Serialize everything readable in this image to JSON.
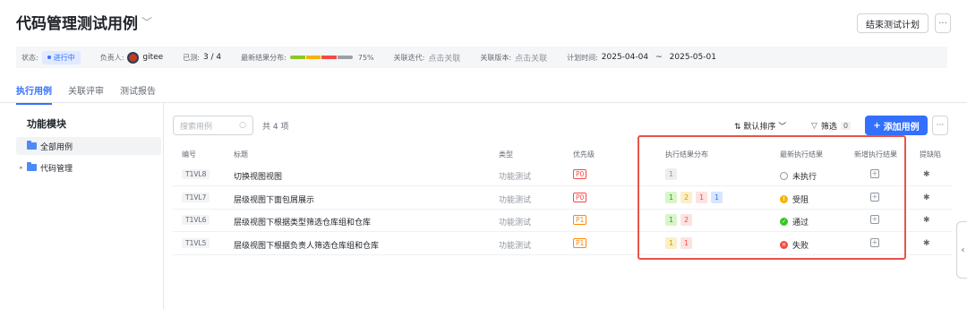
{
  "header": {
    "title": "代码管理测试用例",
    "end_button": "结束测试计划",
    "more_button": "···"
  },
  "info": {
    "status_label": "状态:",
    "status_value": "进行中",
    "owner_label": "负责人:",
    "owner_value": "gitee",
    "tested_label": "已测:",
    "tested_value": "3 / 4",
    "dist_label": "最新结果分布:",
    "dist_percent": "75%",
    "distribution": [
      {
        "color": "#8ac926",
        "fraction": 0.25
      },
      {
        "color": "#f4b400",
        "fraction": 0.25
      },
      {
        "color": "#f54a45",
        "fraction": 0.25
      },
      {
        "color": "#9aa0a6",
        "fraction": 0.25
      }
    ],
    "iteration_label": "关联迭代:",
    "iteration_value": "点击关联",
    "version_label": "关联版本:",
    "version_value": "点击关联",
    "plan_label": "计划时间:",
    "plan_start": "2025-04-04",
    "plan_sep": "~",
    "plan_end": "2025-05-01"
  },
  "tabs": [
    "执行用例",
    "关联评审",
    "测试报告"
  ],
  "sidebar": {
    "title": "功能模块",
    "items": [
      {
        "label": "全部用例"
      },
      {
        "label": "代码管理"
      }
    ]
  },
  "toolbar": {
    "search_placeholder": "搜索用例",
    "count": "共 4 项",
    "sort": "⇅ 默认排序 ﹀",
    "filter": "筛选",
    "filter_count": "0",
    "add": "添加用例",
    "more": "···"
  },
  "columns": {
    "code": "编号",
    "title": "标题",
    "type": "类型",
    "priority": "优先级",
    "dist": "执行结果分布",
    "latest": "最新执行结果",
    "new_result": "新增执行结果",
    "bug": "提缺陷"
  },
  "rows": [
    {
      "code": "T1VL8",
      "title": "切换视图视图",
      "type": "功能测试",
      "priority": "P0",
      "chips": [
        {
          "v": "1",
          "c": "c-gray"
        }
      ],
      "result": "未执行",
      "result_kind": "none"
    },
    {
      "code": "T1VL7",
      "title": "层级视图下面包屑展示",
      "type": "功能测试",
      "priority": "P0",
      "chips": [
        {
          "v": "1",
          "c": "c-green"
        },
        {
          "v": "2",
          "c": "c-yellow"
        },
        {
          "v": "1",
          "c": "c-red"
        },
        {
          "v": "1",
          "c": "c-blue"
        }
      ],
      "result": "受阻",
      "result_kind": "block"
    },
    {
      "code": "T1VL6",
      "title": "层级视图下根据类型筛选仓库组和仓库",
      "type": "功能测试",
      "priority": "P1",
      "chips": [
        {
          "v": "1",
          "c": "c-green"
        },
        {
          "v": "2",
          "c": "c-red"
        }
      ],
      "result": "通过",
      "result_kind": "pass"
    },
    {
      "code": "T1VL5",
      "title": "层级视图下根据负责人筛选仓库组和仓库",
      "type": "功能测试",
      "priority": "P1",
      "chips": [
        {
          "v": "1",
          "c": "c-yellow"
        },
        {
          "v": "1",
          "c": "c-red"
        }
      ],
      "result": "失败",
      "result_kind": "fail"
    }
  ]
}
